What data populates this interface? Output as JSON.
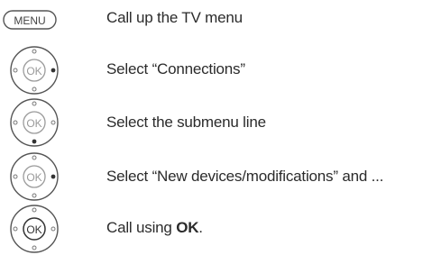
{
  "menu_button_label": "MENU",
  "ok_label": "OK",
  "steps": [
    {
      "control": "menu-button",
      "text": "Call up the TV menu"
    },
    {
      "control": "ok-navigator",
      "active": "right",
      "text": "Select “Connections”"
    },
    {
      "control": "ok-navigator",
      "active": "down",
      "text": "Select the submenu line"
    },
    {
      "control": "ok-navigator",
      "active": "right",
      "text": "Select “New devices/modifications” and ..."
    },
    {
      "control": "ok-navigator",
      "active": "ok",
      "text_prefix": "Call using ",
      "text_bold": "OK",
      "text_suffix": "."
    }
  ],
  "colors": {
    "outline": "#555555",
    "dim_text": "#9a9a9a",
    "active_dot": "#333333",
    "inactive_dot": "#777777"
  }
}
